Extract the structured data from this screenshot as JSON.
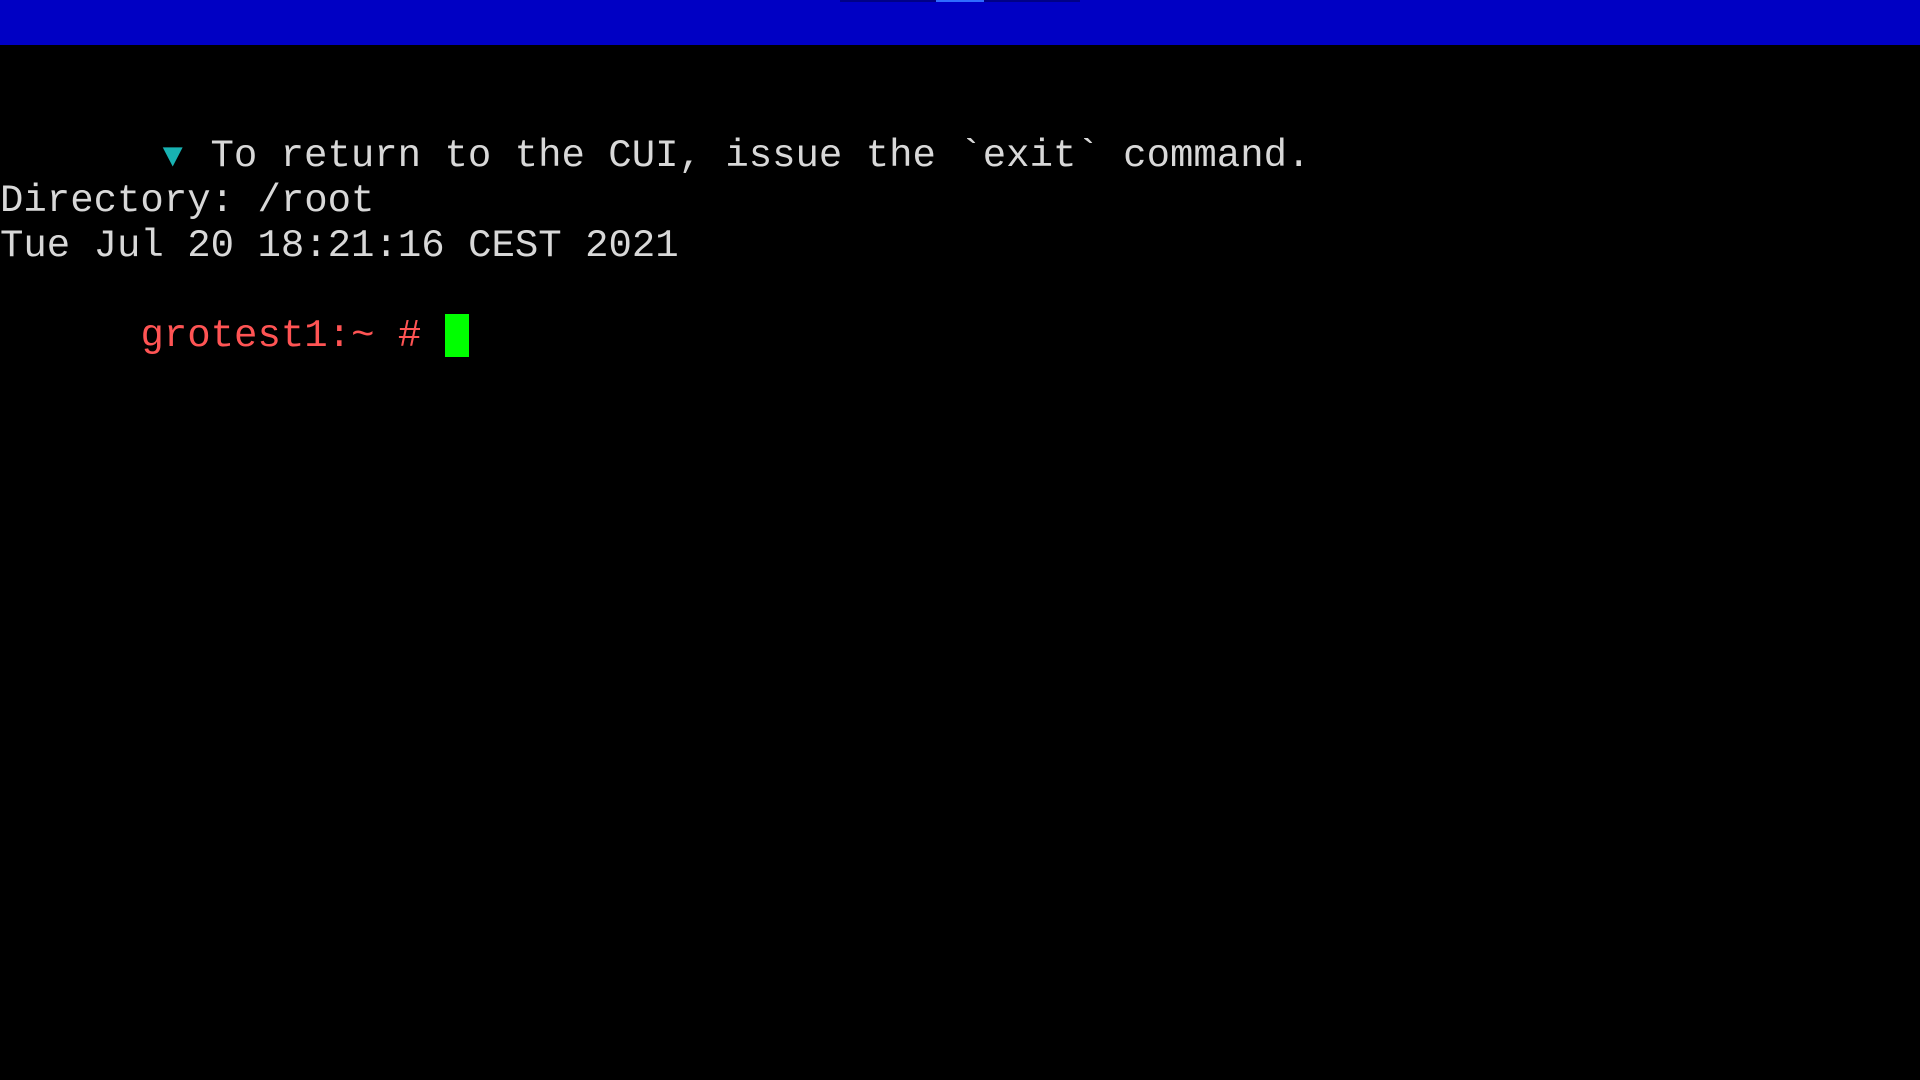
{
  "top_bar": {
    "color": "#0000c4"
  },
  "terminal": {
    "notice": {
      "icon": "triangle-down-icon",
      "icon_glyph": "▼",
      "text": "To return to the CUI, issue the `exit` command."
    },
    "directory_line": "Directory: /root",
    "date_line": "Tue Jul 20 18:21:16 CEST 2021",
    "prompt": "grotest1:~ #",
    "colors": {
      "background": "#000000",
      "text": "#d8d8d8",
      "prompt": "#ff5454",
      "icon": "#18b2b2",
      "cursor": "#00ff00"
    }
  }
}
